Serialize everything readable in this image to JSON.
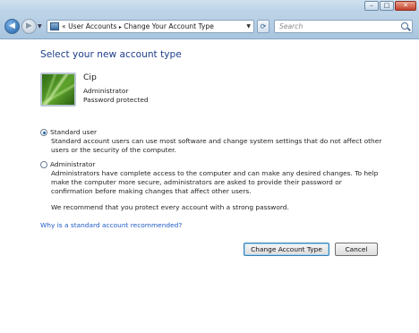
{
  "window": {
    "controls": {
      "minimize": "–",
      "maximize": "□",
      "close": "✕"
    }
  },
  "navbar": {
    "back_icon": "back-arrow-icon",
    "forward_icon": "forward-arrow-icon",
    "address": {
      "separator": "«",
      "path": [
        "User Accounts",
        "Change Your Account Type"
      ],
      "path_separator": "▸"
    },
    "search": {
      "placeholder": "Search"
    }
  },
  "main": {
    "title": "Select your new account type",
    "user": {
      "name": "Cip",
      "role": "Administrator",
      "status": "Password protected"
    },
    "options": [
      {
        "label": "Standard user",
        "selected": true,
        "description": "Standard account users can use most software and change system settings that do not affect other users or the security of the computer."
      },
      {
        "label": "Administrator",
        "selected": false,
        "description": "Administrators have complete access to the computer and can make any desired changes. To help make the computer more secure, administrators are asked to provide their password or confirmation before making changes that affect other users."
      }
    ],
    "recommendation": "We recommend that you protect every account with a strong password.",
    "help_link": "Why is a standard account recommended?",
    "buttons": {
      "change": "Change Account Type",
      "cancel": "Cancel"
    }
  },
  "colors": {
    "title": "#1e3e8a",
    "link": "#1f5cc4",
    "chrome": "#bed4e8"
  }
}
